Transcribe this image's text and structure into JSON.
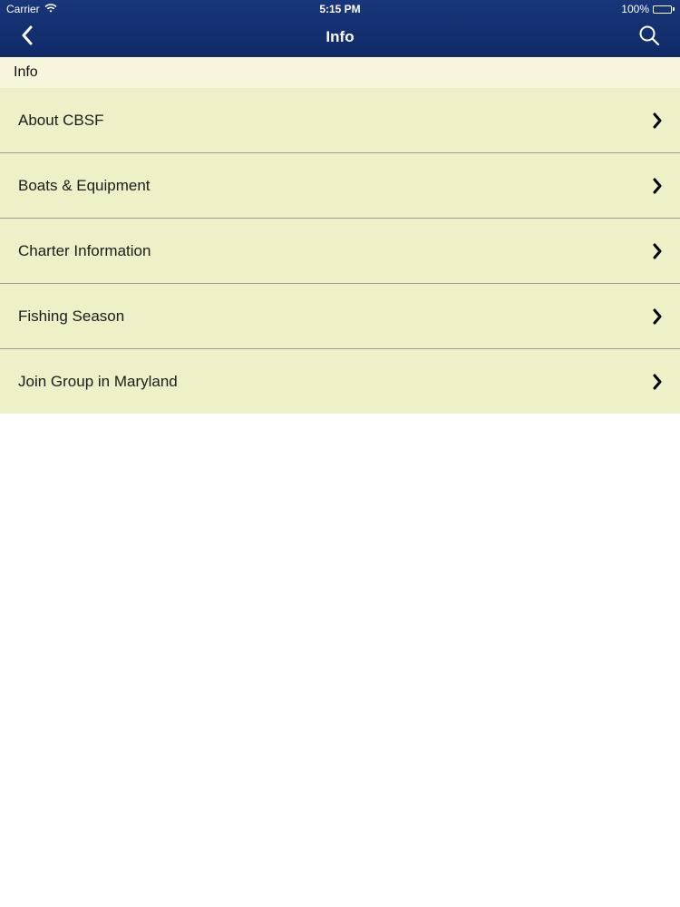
{
  "status_bar": {
    "carrier": "Carrier",
    "time": "5:15 PM",
    "battery": "100%",
    "icons": [
      "wifi-icon",
      "battery-icon"
    ]
  },
  "nav_bar": {
    "title": "Info",
    "back_icon": "chevron-left-icon",
    "search_icon": "search-icon"
  },
  "section": {
    "header": "Info"
  },
  "menu": {
    "items": [
      {
        "label": "About CBSF"
      },
      {
        "label": "Boats & Equipment"
      },
      {
        "label": "Charter Information"
      },
      {
        "label": "Fishing Season"
      },
      {
        "label": "Join Group in Maryland"
      }
    ],
    "item_icon": "chevron-right-icon"
  },
  "colors": {
    "nav_background": "#0e2a68",
    "header_background": "#f7f5dc",
    "row_background": "#efefc8",
    "divider": "#9f9f8e"
  }
}
